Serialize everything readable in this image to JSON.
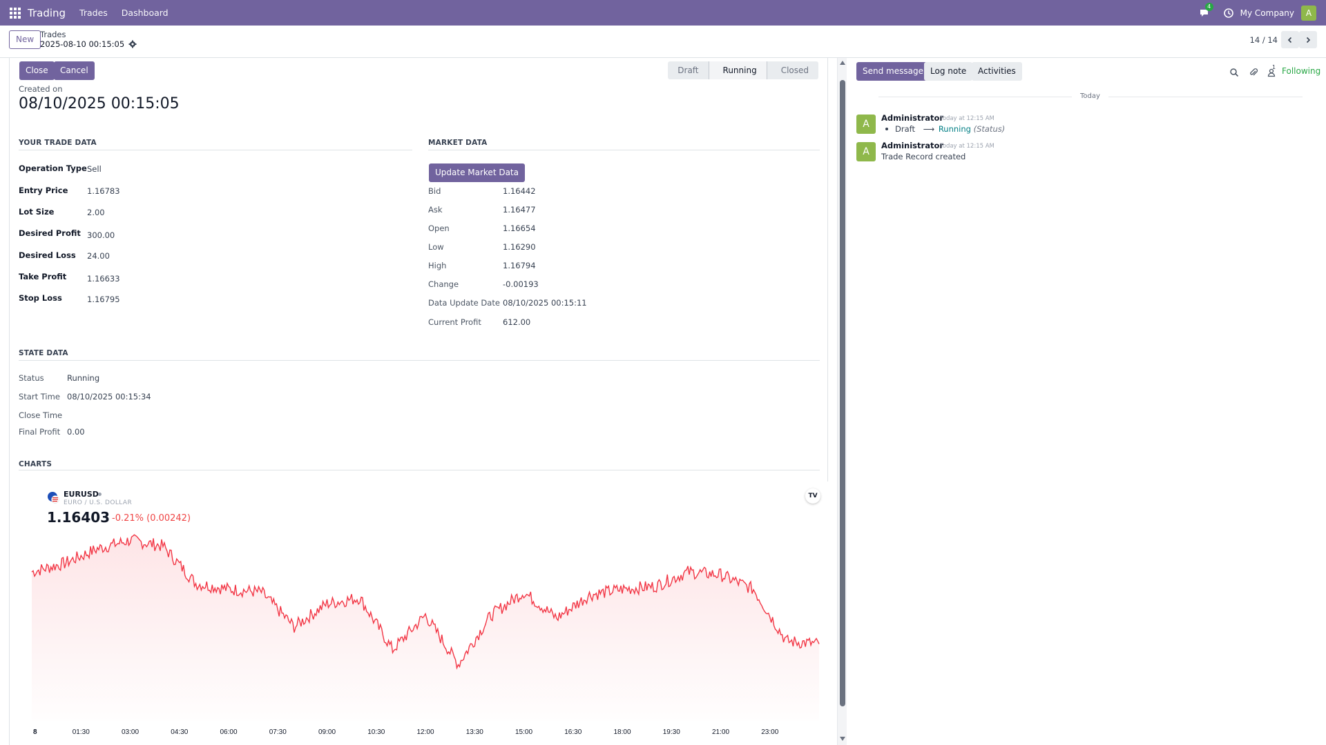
{
  "navbar": {
    "app_name": "Trading",
    "menu": [
      "Trades",
      "Dashboard"
    ],
    "chat_badge": "4",
    "company": "My Company",
    "user_initial": "A"
  },
  "control": {
    "new_label": "New",
    "breadcrumb_parent": "Trades",
    "breadcrumb_current": "2025-08-10 00:15:05",
    "pager": "14 / 14"
  },
  "form": {
    "buttons": {
      "close": "Close",
      "cancel": "Cancel"
    },
    "status_stages": [
      "Draft",
      "Running",
      "Closed"
    ],
    "active_stage": "Running",
    "created_label": "Created on",
    "created_value": "08/10/2025 00:15:05",
    "trade_section": {
      "title": "YOUR TRADE DATA",
      "fields": [
        {
          "label": "Operation Type",
          "value": "Sell"
        },
        {
          "label": "Entry Price",
          "value": "1.16783"
        },
        {
          "label": "Lot Size",
          "value": "2.00"
        },
        {
          "label": "Desired Profit",
          "value": "300.00"
        },
        {
          "label": "Desired Loss",
          "value": "24.00"
        },
        {
          "label": "Take Profit",
          "value": "1.16633"
        },
        {
          "label": "Stop Loss",
          "value": "1.16795"
        }
      ]
    },
    "market_section": {
      "title": "MARKET DATA",
      "update_button": "Update Market Data",
      "fields": [
        {
          "label": "Bid",
          "value": "1.16442"
        },
        {
          "label": "Ask",
          "value": "1.16477"
        },
        {
          "label": "Open",
          "value": "1.16654"
        },
        {
          "label": "Low",
          "value": "1.16290"
        },
        {
          "label": "High",
          "value": "1.16794"
        },
        {
          "label": "Change",
          "value": "-0.00193"
        },
        {
          "label": "Data Update Date",
          "value": "08/10/2025 00:15:11"
        },
        {
          "label": "Current Profit",
          "value": "612.00"
        }
      ]
    },
    "state_section": {
      "title": "STATE DATA",
      "fields": [
        {
          "label": "Status",
          "value": "Running"
        },
        {
          "label": "Start Time",
          "value": "08/10/2025 00:15:34"
        },
        {
          "label": "Close Time",
          "value": ""
        },
        {
          "label": "Final Profit",
          "value": "0.00"
        }
      ]
    },
    "charts_section": {
      "title": "CHARTS"
    }
  },
  "widget": {
    "symbol": "EURUSD",
    "description": "EURO / U.S. DOLLAR",
    "price": "1.16403",
    "change": "-0.21% (0.00242)",
    "logo": "TV"
  },
  "chart_data": {
    "type": "area",
    "x_tick_labels": [
      "8",
      "01:30",
      "03:00",
      "04:30",
      "06:00",
      "07:30",
      "09:00",
      "10:30",
      "12:00",
      "13:30",
      "15:00",
      "16:30",
      "18:00",
      "19:30",
      "21:00",
      "23:00"
    ],
    "x_hours": [
      0,
      1.5,
      3,
      4.5,
      6,
      7.5,
      9,
      10.5,
      12,
      13.5,
      15,
      16.5,
      18,
      19.5,
      21,
      22.5,
      24
    ],
    "y_values": [
      1.1668,
      1.1671,
      1.1676,
      1.1679,
      1.1677,
      1.1664,
      1.1662,
      1.1661,
      1.1649,
      1.1657,
      1.1659,
      1.1641,
      1.1653,
      1.1636,
      1.1653,
      1.1661,
      1.1652,
      1.166,
      1.1662,
      1.1663,
      1.1668,
      1.1667,
      1.1662,
      1.1644,
      1.1643
    ],
    "ylim": [
      1.163,
      1.1685
    ],
    "line_color": "#f23645",
    "fill_color": "#fde2e4"
  },
  "chatter": {
    "send_message": "Send message",
    "log_note": "Log note",
    "activities": "Activities",
    "follower_count": "1",
    "following": "Following",
    "day_label": "Today",
    "messages": [
      {
        "author": "Administrator",
        "time": "Today at 12:15 AM",
        "old_value": "Draft",
        "new_value": "Running",
        "field": "(Status)"
      },
      {
        "author": "Administrator",
        "time": "Today at 12:15 AM",
        "body": "Trade Record created"
      }
    ]
  },
  "colors": {
    "brand": "#71639e",
    "success": "#28a745",
    "link": "#017e84"
  }
}
